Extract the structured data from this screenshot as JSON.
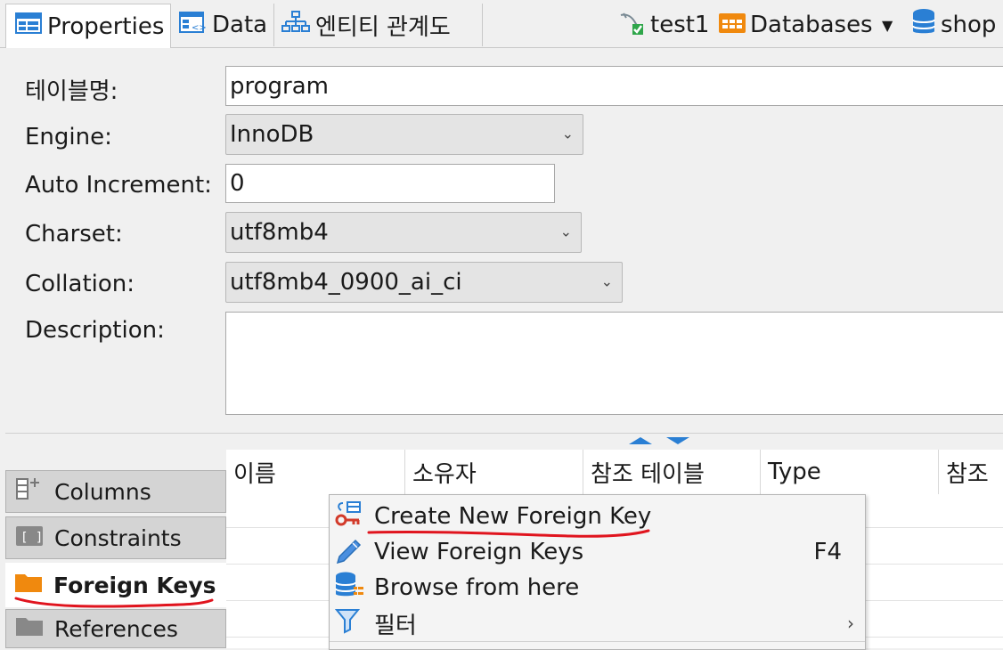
{
  "tabs": [
    {
      "label": "Properties",
      "icon": "properties-icon"
    },
    {
      "label": "Data",
      "icon": "data-grid-icon"
    },
    {
      "label": "엔티티 관계도",
      "icon": "er-diagram-icon"
    }
  ],
  "breadcrumb": {
    "connection": "test1",
    "folder": "Databases",
    "database": "shop"
  },
  "properties": {
    "table_name_label": "테이블명:",
    "table_name": "program",
    "engine_label": "Engine:",
    "engine": "InnoDB",
    "auto_increment_label": "Auto Increment:",
    "auto_increment": "0",
    "charset_label": "Charset:",
    "charset": "utf8mb4",
    "collation_label": "Collation:",
    "collation": "utf8mb4_0900_ai_ci",
    "description_label": "Description:",
    "description": ""
  },
  "side_tabs": [
    {
      "label": "Columns",
      "icon": "columns-icon"
    },
    {
      "label": "Constraints",
      "icon": "constraints-icon"
    },
    {
      "label": "Foreign Keys",
      "icon": "folder-icon",
      "active": true
    },
    {
      "label": "References",
      "icon": "folder-icon"
    }
  ],
  "grid": {
    "columns": [
      "이름",
      "소유자",
      "참조 테이블",
      "Type",
      "참조"
    ]
  },
  "context_menu": {
    "items": [
      {
        "label": "Create New Foreign Key",
        "icon": "new-key-icon",
        "shortcut": ""
      },
      {
        "label": "View Foreign Keys",
        "icon": "pencil-icon",
        "shortcut": "F4"
      },
      {
        "label": "Browse from here",
        "icon": "database-browse-icon",
        "shortcut": ""
      },
      {
        "label": "필터",
        "icon": "filter-icon",
        "shortcut": ""
      }
    ]
  },
  "colors": {
    "accent_blue": "#2a7fd4",
    "folder_orange": "#f0890e",
    "annotation_red": "#e0141e"
  }
}
